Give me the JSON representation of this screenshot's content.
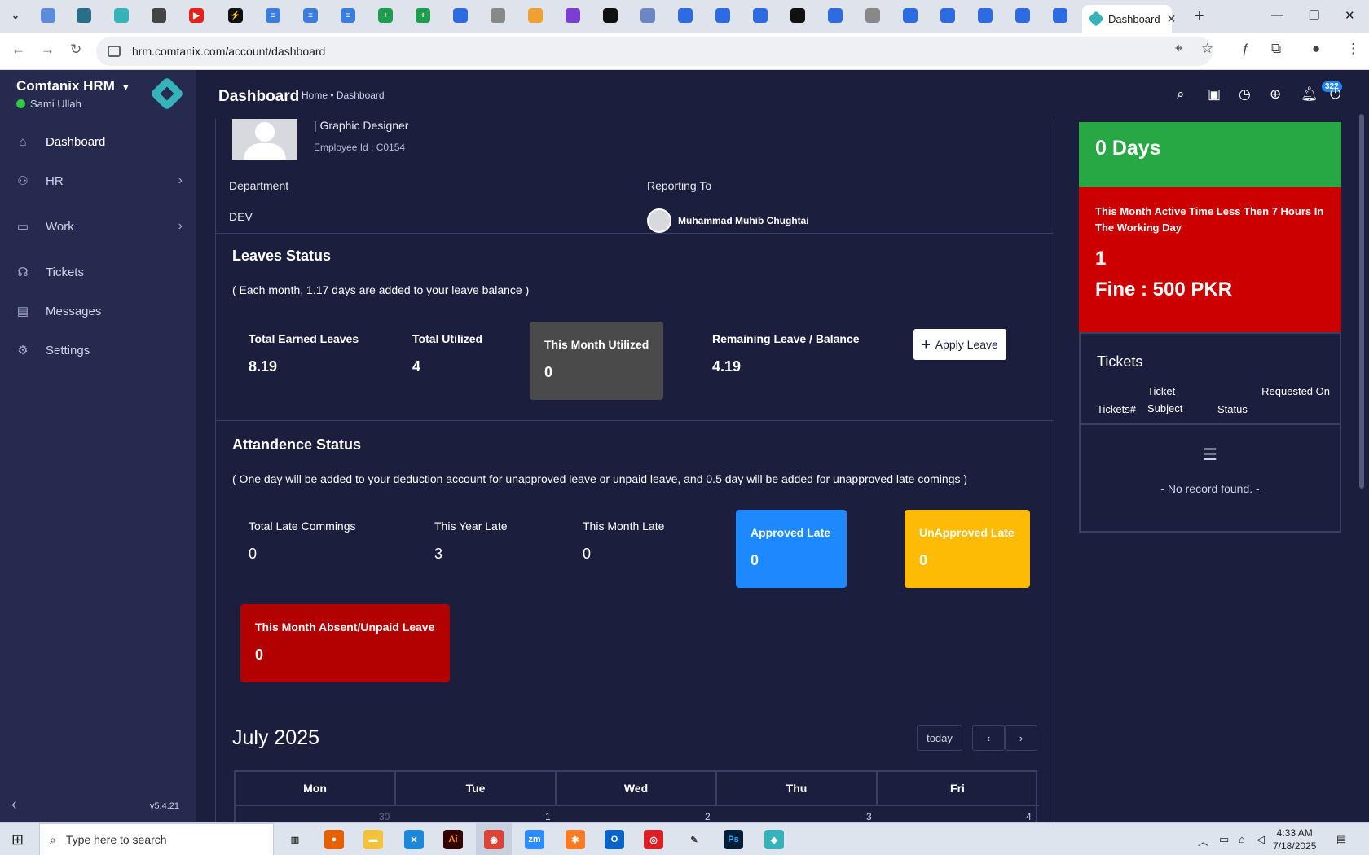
{
  "browser": {
    "active_tab_title": "Dashboard",
    "new_tab_label": "+",
    "url": "hrm.comtanix.com/account/dashboard"
  },
  "sidebar": {
    "brand": "Comtanix HRM",
    "user_name": "Sami Ullah",
    "items": [
      {
        "label": "Dashboard",
        "icon": "home-icon"
      },
      {
        "label": "HR",
        "icon": "users-icon"
      },
      {
        "label": "Work",
        "icon": "briefcase-icon"
      },
      {
        "label": "Tickets",
        "icon": "headset-icon"
      },
      {
        "label": "Messages",
        "icon": "message-icon"
      },
      {
        "label": "Settings",
        "icon": "gear-icon"
      }
    ],
    "version": "v5.4.21"
  },
  "header": {
    "title": "Dashboard",
    "breadcrumb": "Home • Dashboard",
    "notification_count": "322"
  },
  "profile": {
    "role": "| Graphic Designer",
    "employee_id": "Employee Id : C0154",
    "department_label": "Department",
    "department_value": "DEV",
    "reporting_label": "Reporting To",
    "reporting_value": "Muhammad Muhib Chughtai"
  },
  "leaves": {
    "title": "Leaves Status",
    "note": "( Each month, 1.17 days are added to your leave balance )",
    "total_earned_label": "Total Earned Leaves",
    "total_earned_value": "8.19",
    "total_utilized_label": "Total Utilized",
    "total_utilized_value": "4",
    "month_utilized_label": "This Month Utilized",
    "month_utilized_value": "0",
    "remaining_label": "Remaining Leave / Balance",
    "remaining_value": "4.19",
    "apply_button": "Apply Leave"
  },
  "attendance": {
    "title": "Attandence Status",
    "note": "( One day will be added to your deduction account for unapproved leave or unpaid leave, and 0.5 day will be added for unapproved late comings )",
    "total_late_label": "Total Late Commings",
    "total_late_value": "0",
    "year_late_label": "This Year Late",
    "year_late_value": "3",
    "month_late_label": "This Month Late",
    "month_late_value": "0",
    "approved_late_label": "Approved Late",
    "approved_late_value": "0",
    "unapproved_late_label": "UnApproved Late",
    "unapproved_late_value": "0",
    "absent_label": "This Month Absent/Unpaid Leave",
    "absent_value": "0",
    "colors": {
      "approved": "#1e88ff",
      "unapproved": "#fdbb05",
      "absent": "#b30000"
    }
  },
  "calendar": {
    "title": "July 2025",
    "today_button": "today",
    "prev_icon": "chevron-left-icon",
    "next_icon": "chevron-right-icon",
    "days": [
      "Mon",
      "Tue",
      "Wed",
      "Thu",
      "Fri"
    ],
    "dates": [
      "30",
      "1",
      "2",
      "3",
      "4"
    ]
  },
  "summary": {
    "days_value": "0 Days",
    "active_time_msg": "This Month Active Time Less Then 7 Hours In The Working Day",
    "active_time_count": "1",
    "fine": "Fine : 500 PKR"
  },
  "tickets": {
    "title": "Tickets",
    "col_number": "Tickets#",
    "col_subject": "Ticket Subject",
    "col_status": "Status",
    "col_requested": "Requested On",
    "empty": "- No record found. -"
  },
  "taskbar": {
    "search_placeholder": "Type here to search",
    "time": "4:33 AM",
    "date": "7/18/2025"
  }
}
